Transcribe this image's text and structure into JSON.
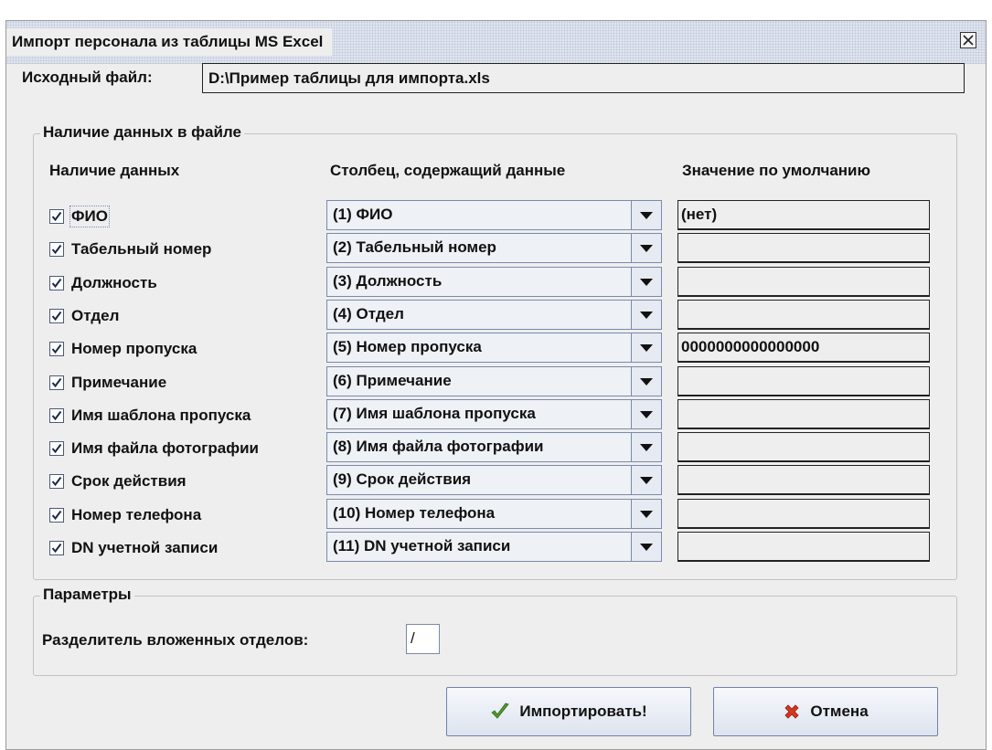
{
  "window": {
    "title": "Импорт персонала из таблицы MS Excel",
    "close_icon": "close-icon"
  },
  "source": {
    "label": "Исходный файл:",
    "path": "D:\\Пример таблицы для импорта.xls"
  },
  "data_group": {
    "legend": "Наличие данных в файле",
    "col_presence": "Наличие данных",
    "col_column": "Столбец, содержащий данные",
    "col_default": "Значение по умолчанию",
    "rows": [
      {
        "label": "ФИО",
        "checked": true,
        "column": "(1) ФИО",
        "default": "(нет)"
      },
      {
        "label": "Табельный номер",
        "checked": true,
        "column": "(2) Табельный номер",
        "default": ""
      },
      {
        "label": "Должность",
        "checked": true,
        "column": "(3) Должность",
        "default": ""
      },
      {
        "label": "Отдел",
        "checked": true,
        "column": "(4) Отдел",
        "default": ""
      },
      {
        "label": "Номер пропуска",
        "checked": true,
        "column": "(5) Номер пропуска",
        "default": "0000000000000000"
      },
      {
        "label": "Примечание",
        "checked": true,
        "column": "(6) Примечание",
        "default": ""
      },
      {
        "label": "Имя шаблона пропуска",
        "checked": true,
        "column": "(7) Имя шаблона пропуска",
        "default": ""
      },
      {
        "label": "Имя файла фотографии",
        "checked": true,
        "column": "(8) Имя файла фотографии",
        "default": ""
      },
      {
        "label": "Срок действия",
        "checked": true,
        "column": "(9) Срок действия",
        "default": ""
      },
      {
        "label": "Номер телефона",
        "checked": true,
        "column": "(10) Номер телефона",
        "default": ""
      },
      {
        "label": "DN учетной записи",
        "checked": true,
        "column": "(11) DN учетной записи",
        "default": ""
      }
    ]
  },
  "params_group": {
    "legend": "Параметры",
    "separator_label": "Разделитель вложенных отделов:",
    "separator_value": "/"
  },
  "buttons": {
    "import_label": "Импортировать!",
    "import_icon": "checkmark-icon",
    "cancel_label": "Отмена",
    "cancel_icon": "cross-icon"
  },
  "colors": {
    "import_check": "#4f9a2a",
    "cancel_cross": "#d8361f"
  }
}
